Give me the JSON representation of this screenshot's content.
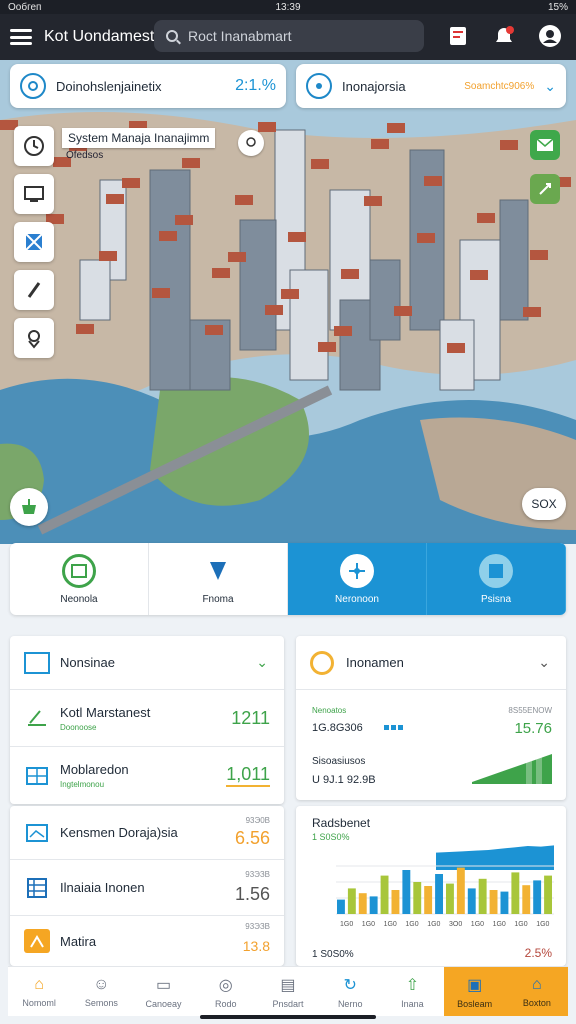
{
  "status": {
    "carrier": "Ообгеп",
    "time": "13:39",
    "battery": "15%"
  },
  "header": {
    "title": "Kot Uondamest",
    "search_placeholder": "Roct Inanabmart"
  },
  "map": {
    "card_left": {
      "label": "Doinohslenjainetix",
      "value": "2:1.%"
    },
    "card_right": {
      "label": "Inonajorsia",
      "value": "Soamchtc906%"
    },
    "label": "System Manaja Inanajimm",
    "sublabel": "Ofedsos",
    "zoom": "SOX"
  },
  "tabs": [
    {
      "label": "Neonola"
    },
    {
      "label": "Fnoma"
    },
    {
      "label": "Neronoon"
    },
    {
      "label": "Psisna"
    }
  ],
  "left_panel": {
    "header": "Nonsinae",
    "rows": [
      {
        "title": "Kotl Marstanest",
        "sub": "Doonoose",
        "value": "1211",
        "small": ""
      },
      {
        "title": "Moblaredon",
        "sub": "Ingtelmonou",
        "value": "1,011",
        "small": ""
      },
      {
        "title": "Kensmen Doraja)sia",
        "sub": "",
        "value": "6.56",
        "small": "93Э0В"
      },
      {
        "title": "Ilnaiaia Inonen",
        "sub": "",
        "value": "1.56",
        "small": "93ЭЗВ"
      },
      {
        "title": "Matira",
        "sub": "",
        "value": "13.8",
        "small": "93ЭЗВ"
      }
    ]
  },
  "right_panel": {
    "header": "Inonamen",
    "stat1": {
      "label": "Nenoatos",
      "value": "1G.8G306",
      "right_label": "8S55ENOW",
      "right_value": "15.76"
    },
    "stat2": {
      "label": "Sisoasiusos",
      "value": "U 9J.1 92.9B",
      "suffix": "%"
    },
    "chart_title": "Radsbenet",
    "chart_sub": "1 S0S0%",
    "footer_left": "1 S0S0%",
    "footer_right": "2.5%",
    "x_ticks": [
      "1G0",
      "1G0",
      "1G0",
      "1G0",
      "1G0",
      "3O0",
      "1G0",
      "1G0",
      "1G0",
      "1G0"
    ]
  },
  "bottom_nav": [
    {
      "label": "Nomoml"
    },
    {
      "label": "Semons"
    },
    {
      "label": "Canoeay"
    },
    {
      "label": "Rodo"
    },
    {
      "label": "Pnsdart"
    },
    {
      "label": "Nerno"
    },
    {
      "label": "Inana"
    },
    {
      "label": "Bosleam"
    },
    {
      "label": "Boxton"
    }
  ],
  "chart_data": {
    "type": "bar",
    "title": "Radsbenet",
    "categories": [
      "1G0",
      "1G0",
      "1G0",
      "1G0",
      "1G0",
      "3O0",
      "1G0",
      "1G0",
      "1G0",
      "1G0"
    ],
    "series": [
      {
        "values": [
          18,
          32,
          26,
          22,
          48,
          30,
          55,
          40,
          35,
          50,
          38,
          58,
          32,
          44,
          30,
          28,
          52,
          36,
          42,
          48
        ]
      }
    ],
    "area_series": [
      10,
      12,
      14,
      16,
      18,
      22,
      26,
      30,
      28,
      32
    ],
    "accent": "#1c93d4",
    "secondary": "#a8c63a",
    "tertiary": "#f2b233"
  },
  "colors": {
    "brand": "#1c93d4",
    "accent_orange": "#f5a623",
    "green": "#3ea34a"
  }
}
